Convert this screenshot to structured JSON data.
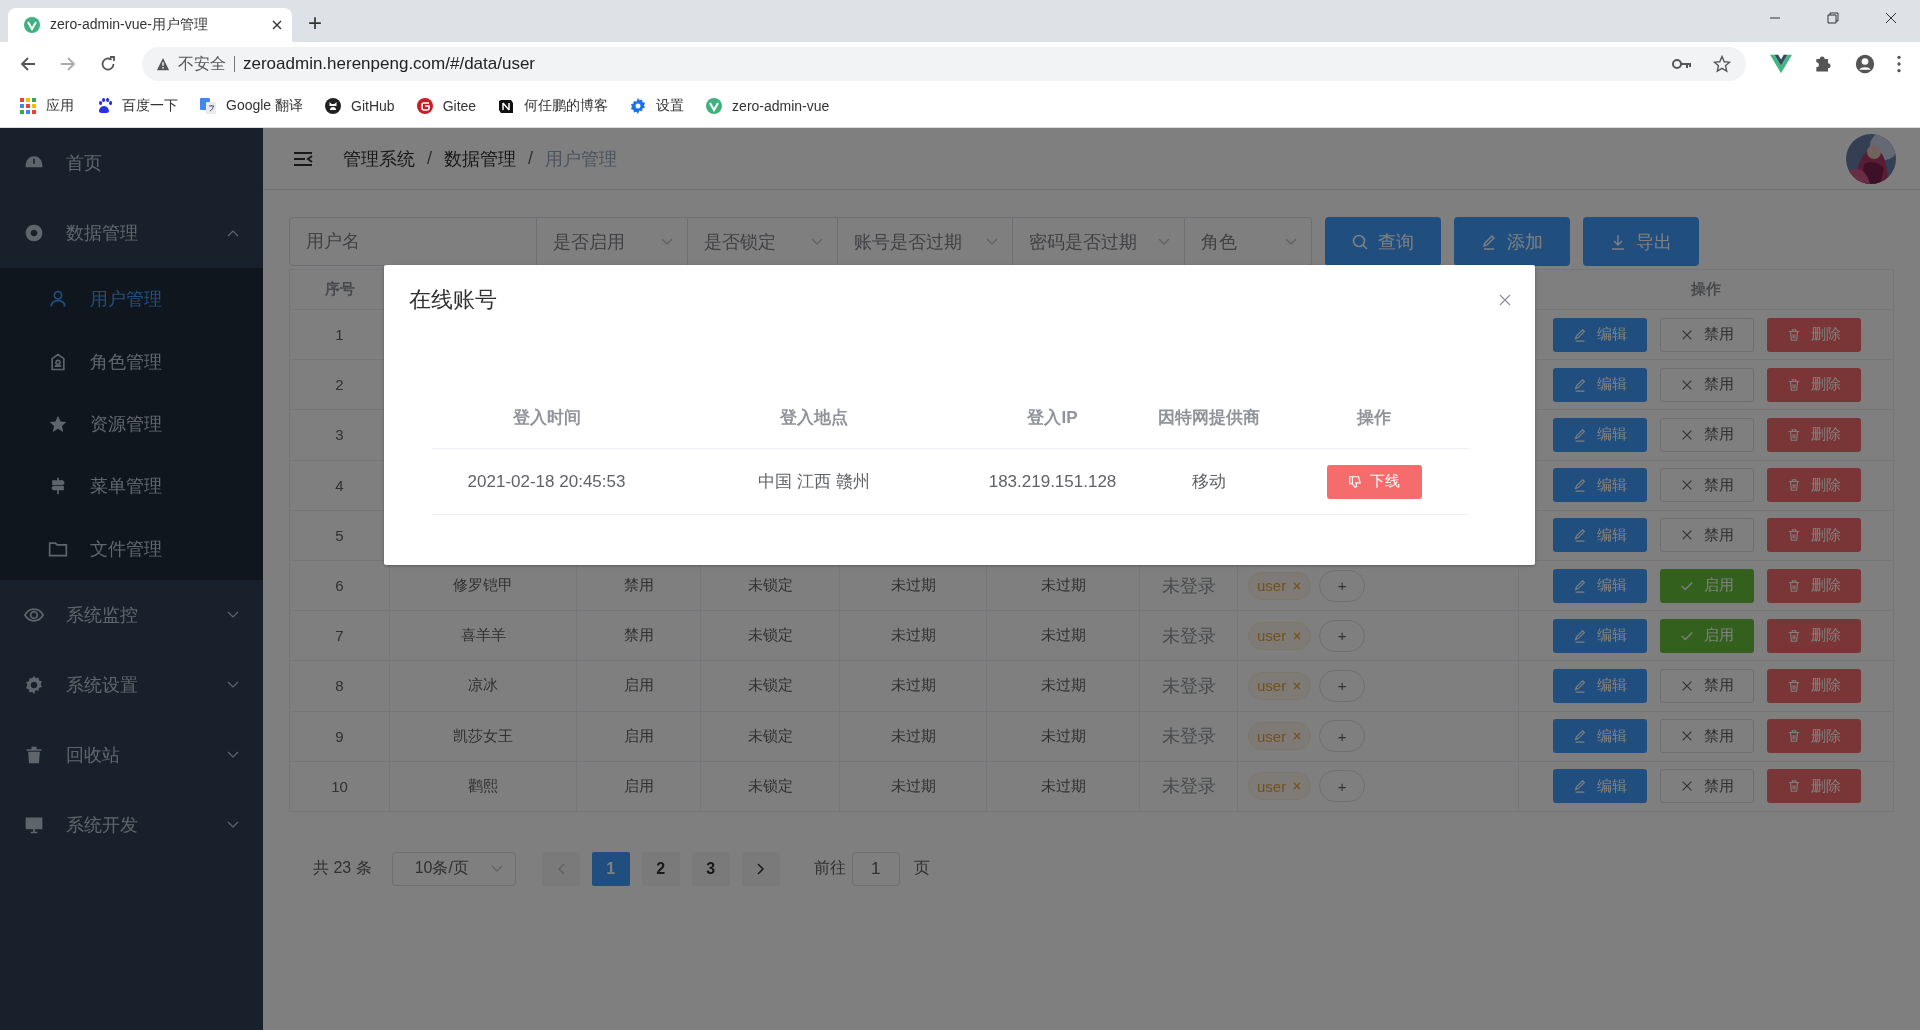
{
  "browser": {
    "tab": {
      "title": "zero-admin-vue-用户管理"
    },
    "new_tab": "+",
    "address": {
      "security": "不安全",
      "url": "zeroadmin.herenpeng.com/#/data/user"
    },
    "bookmarks": [
      {
        "label": "应用",
        "kind": "apps"
      },
      {
        "label": "百度一下",
        "kind": "paw"
      },
      {
        "label": "Google 翻译",
        "kind": "translate"
      },
      {
        "label": "GitHub",
        "kind": "github"
      },
      {
        "label": "Gitee",
        "kind": "gitee"
      },
      {
        "label": "何任鹏的博客",
        "kind": "notion"
      },
      {
        "label": "设置",
        "kind": "gear"
      },
      {
        "label": "zero-admin-vue",
        "kind": "vue"
      }
    ]
  },
  "sidebar": {
    "items": [
      {
        "label": "首页",
        "kind": "gauge",
        "selected": false
      },
      {
        "label": "数据管理",
        "kind": "lifebuoy",
        "selected": false,
        "expanded": true,
        "children": [
          {
            "label": "用户管理",
            "kind": "user",
            "selected": true
          },
          {
            "label": "角色管理",
            "kind": "badge",
            "selected": false
          },
          {
            "label": "资源管理",
            "kind": "star",
            "selected": false
          },
          {
            "label": "菜单管理",
            "kind": "sign",
            "selected": false
          },
          {
            "label": "文件管理",
            "kind": "folder",
            "selected": false
          }
        ]
      },
      {
        "label": "系统监控",
        "kind": "eye",
        "selected": false,
        "expanded": false
      },
      {
        "label": "系统设置",
        "kind": "gear",
        "selected": false,
        "expanded": false
      },
      {
        "label": "回收站",
        "kind": "trash",
        "selected": false,
        "expanded": false
      },
      {
        "label": "系统开发",
        "kind": "monitor",
        "selected": false,
        "expanded": false
      }
    ]
  },
  "breadcrumb": {
    "separator": "/",
    "items": [
      {
        "label": "管理系统",
        "current": false
      },
      {
        "label": "数据管理",
        "current": false
      },
      {
        "label": "用户管理",
        "current": true
      }
    ]
  },
  "filters": {
    "username": {
      "placeholder": "用户名"
    },
    "selects": [
      {
        "placeholder": "是否启用"
      },
      {
        "placeholder": "是否锁定"
      },
      {
        "placeholder": "账号是否过期"
      },
      {
        "placeholder": "密码是否过期"
      },
      {
        "placeholder": "角色"
      }
    ],
    "buttons": [
      {
        "kind": "search",
        "label": "查询"
      },
      {
        "kind": "add",
        "label": "添加"
      },
      {
        "kind": "export",
        "label": "导出"
      }
    ]
  },
  "table": {
    "index_header": "序号",
    "actions_header": "操作",
    "rows": [
      {
        "index": "1",
        "actions": [
          {
            "kind": "edit",
            "label": "编辑"
          },
          {
            "kind": "disable",
            "label": "禁用"
          },
          {
            "kind": "delete",
            "label": "删除"
          }
        ]
      },
      {
        "index": "2",
        "actions": [
          {
            "kind": "edit",
            "label": "编辑"
          },
          {
            "kind": "disable",
            "label": "禁用"
          },
          {
            "kind": "delete",
            "label": "删除"
          }
        ]
      },
      {
        "index": "3",
        "actions": [
          {
            "kind": "edit",
            "label": "编辑"
          },
          {
            "kind": "disable",
            "label": "禁用"
          },
          {
            "kind": "delete",
            "label": "删除"
          }
        ]
      },
      {
        "index": "4",
        "actions": [
          {
            "kind": "edit",
            "label": "编辑"
          },
          {
            "kind": "disable",
            "label": "禁用"
          },
          {
            "kind": "delete",
            "label": "删除"
          }
        ]
      },
      {
        "index": "5",
        "actions": [
          {
            "kind": "edit",
            "label": "编辑"
          },
          {
            "kind": "disable",
            "label": "禁用"
          },
          {
            "kind": "delete",
            "label": "删除"
          }
        ]
      },
      {
        "index": "6",
        "cells": [
          "修罗铠甲",
          "禁用",
          "未锁定",
          "未过期",
          "未过期"
        ],
        "login": "未登录",
        "roles": [
          {
            "label": "user"
          }
        ],
        "add_role": "+",
        "actions": [
          {
            "kind": "edit",
            "label": "编辑"
          },
          {
            "kind": "enable",
            "label": "启用"
          },
          {
            "kind": "delete",
            "label": "删除"
          }
        ]
      },
      {
        "index": "7",
        "cells": [
          "喜羊羊",
          "禁用",
          "未锁定",
          "未过期",
          "未过期"
        ],
        "login": "未登录",
        "roles": [
          {
            "label": "user"
          }
        ],
        "add_role": "+",
        "actions": [
          {
            "kind": "edit",
            "label": "编辑"
          },
          {
            "kind": "enable",
            "label": "启用"
          },
          {
            "kind": "delete",
            "label": "删除"
          }
        ]
      },
      {
        "index": "8",
        "cells": [
          "凉冰",
          "启用",
          "未锁定",
          "未过期",
          "未过期"
        ],
        "login": "未登录",
        "roles": [
          {
            "label": "user"
          }
        ],
        "add_role": "+",
        "actions": [
          {
            "kind": "edit",
            "label": "编辑"
          },
          {
            "kind": "disable",
            "label": "禁用"
          },
          {
            "kind": "delete",
            "label": "删除"
          }
        ]
      },
      {
        "index": "9",
        "cells": [
          "凯莎女王",
          "启用",
          "未锁定",
          "未过期",
          "未过期"
        ],
        "login": "未登录",
        "roles": [
          {
            "label": "user"
          }
        ],
        "add_role": "+",
        "actions": [
          {
            "kind": "edit",
            "label": "编辑"
          },
          {
            "kind": "disable",
            "label": "禁用"
          },
          {
            "kind": "delete",
            "label": "删除"
          }
        ]
      },
      {
        "index": "10",
        "cells": [
          "鹳熙",
          "启用",
          "未锁定",
          "未过期",
          "未过期"
        ],
        "login": "未登录",
        "roles": [
          {
            "label": "user"
          }
        ],
        "add_role": "+",
        "actions": [
          {
            "kind": "edit",
            "label": "编辑"
          },
          {
            "kind": "disable",
            "label": "禁用"
          },
          {
            "kind": "delete",
            "label": "删除"
          }
        ]
      }
    ]
  },
  "pagination": {
    "total": "共 23 条",
    "page_size": "10条/页",
    "pages": [
      {
        "label": "1",
        "selected": true
      },
      {
        "label": "2",
        "selected": false
      },
      {
        "label": "3",
        "selected": false
      }
    ],
    "goto_label": "前往",
    "goto_value": "1",
    "page_suffix": "页"
  },
  "modal": {
    "title": "在线账号",
    "columns": [
      "登入时间",
      "登入地点",
      "登入IP",
      "因特网提供商",
      "操作"
    ],
    "rows": [
      {
        "cells": [
          "2021-02-18 20:45:53",
          "中国 江西 赣州",
          "183.219.151.128",
          "移动"
        ],
        "action": "下线"
      }
    ]
  }
}
